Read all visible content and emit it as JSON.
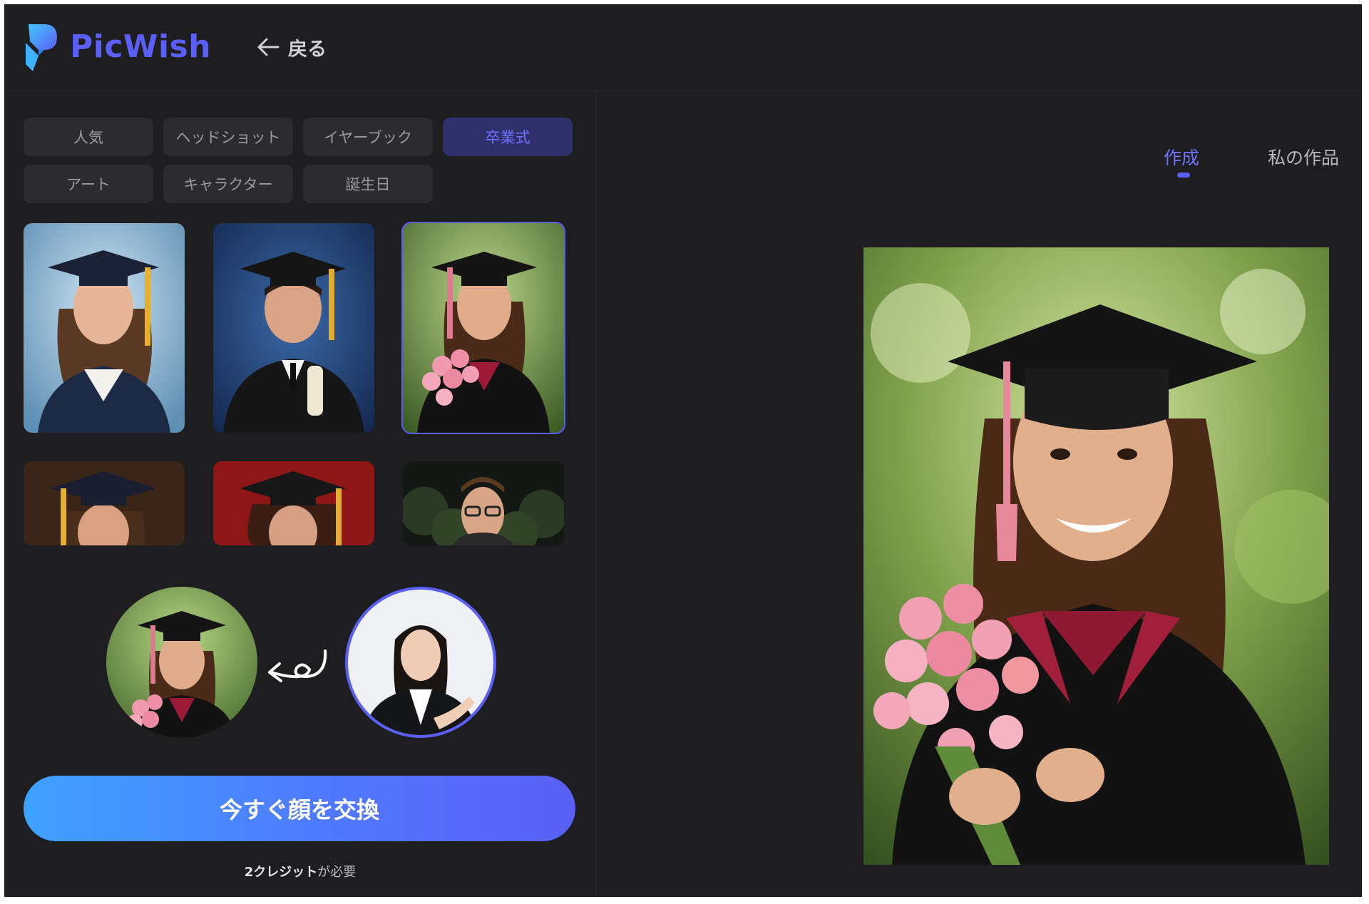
{
  "app": {
    "brand": "PicWish",
    "back_label": "戻る"
  },
  "categories": [
    {
      "label": "人気",
      "active": false
    },
    {
      "label": "ヘッドショット",
      "active": false
    },
    {
      "label": "イヤーブック",
      "active": false
    },
    {
      "label": "卒業式",
      "active": true
    },
    {
      "label": "アート",
      "active": false
    },
    {
      "label": "キャラクター",
      "active": false
    },
    {
      "label": "誕生日",
      "active": false
    }
  ],
  "templates": [
    {
      "name": "graduate-girl-blue",
      "selected": false
    },
    {
      "name": "graduate-boy-blue",
      "selected": false
    },
    {
      "name": "graduate-girl-flowers",
      "selected": true
    },
    {
      "name": "graduate-girl-brown",
      "selected": false
    },
    {
      "name": "graduate-girl-red",
      "selected": false
    },
    {
      "name": "graduate-man-glasses",
      "selected": false
    }
  ],
  "swap_button": {
    "label": "今すぐ顔を交換"
  },
  "credits": {
    "amount": "2クレジット",
    "suffix": "が必要"
  },
  "tabs": {
    "create": "作成",
    "my_works": "私の作品"
  },
  "colors": {
    "accent": "#5b5ff5",
    "background": "#1e1e21",
    "chip": "#2b2b30"
  }
}
